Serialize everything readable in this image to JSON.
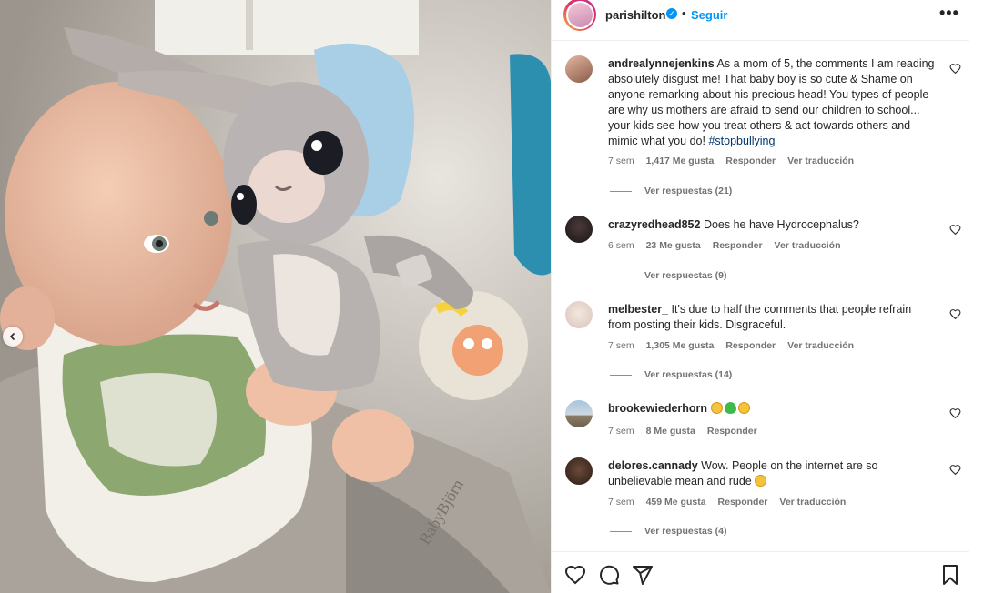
{
  "post": {
    "username": "parishilton",
    "dot": "•",
    "follow_label": "Seguir",
    "more_label": "•••",
    "photo_brand_text": "BabyBjörn"
  },
  "icons": {
    "verified": "verified-badge-icon",
    "heart": "heart-outline-icon",
    "comment": "comment-icon",
    "share": "paper-plane-icon",
    "save": "bookmark-icon",
    "carousel": "chevron-left-icon",
    "more": "more-dots-icon"
  },
  "colors": {
    "link_blue": "#0095f6",
    "hashtag": "#00376b",
    "meta_gray": "#737373"
  },
  "comments": [
    {
      "username": "andrealynnejenkins",
      "text": "As a mom of 5, the comments I am reading absolutely disgust me! That baby boy is so cute & Shame on anyone remarking about his precious head! You types of people are why us mothers are afraid to send our children to school... your kids see how you treat others & act towards others and mimic what you do! ",
      "hashtag": "#stopbullying",
      "time": "7 sem",
      "likes": "1,417 Me gusta",
      "reply_label": "Responder",
      "translate_label": "Ver traducción",
      "replies_label": "Ver respuestas (21)"
    },
    {
      "username": "crazyredhead852",
      "text": "Does he have Hydrocephalus?",
      "time": "6 sem",
      "likes": "23 Me gusta",
      "reply_label": "Responder",
      "translate_label": "Ver traducción",
      "replies_label": "Ver respuestas (9)"
    },
    {
      "username": "melbester_",
      "text": "It's due to half the comments that people refrain from posting their kids. Disgraceful.",
      "time": "7 sem",
      "likes": "1,305 Me gusta",
      "reply_label": "Responder",
      "translate_label": "Ver traducción",
      "replies_label": "Ver respuestas (14)"
    },
    {
      "username": "brookewiederhorn",
      "text": "",
      "emojis": [
        "smiling-face-with-heart-eyes",
        "green-heart",
        "smiling-face-with-heart-eyes"
      ],
      "time": "7 sem",
      "likes": "8 Me gusta",
      "reply_label": "Responder"
    },
    {
      "username": "delores.cannady",
      "text": "Wow. People on the internet are so unbelievable mean and rude ",
      "emojis": [
        "astonished-face"
      ],
      "time": "7 sem",
      "likes": "459 Me gusta",
      "reply_label": "Responder",
      "translate_label": "Ver traducción",
      "replies_label": "Ver respuestas (4)"
    }
  ]
}
